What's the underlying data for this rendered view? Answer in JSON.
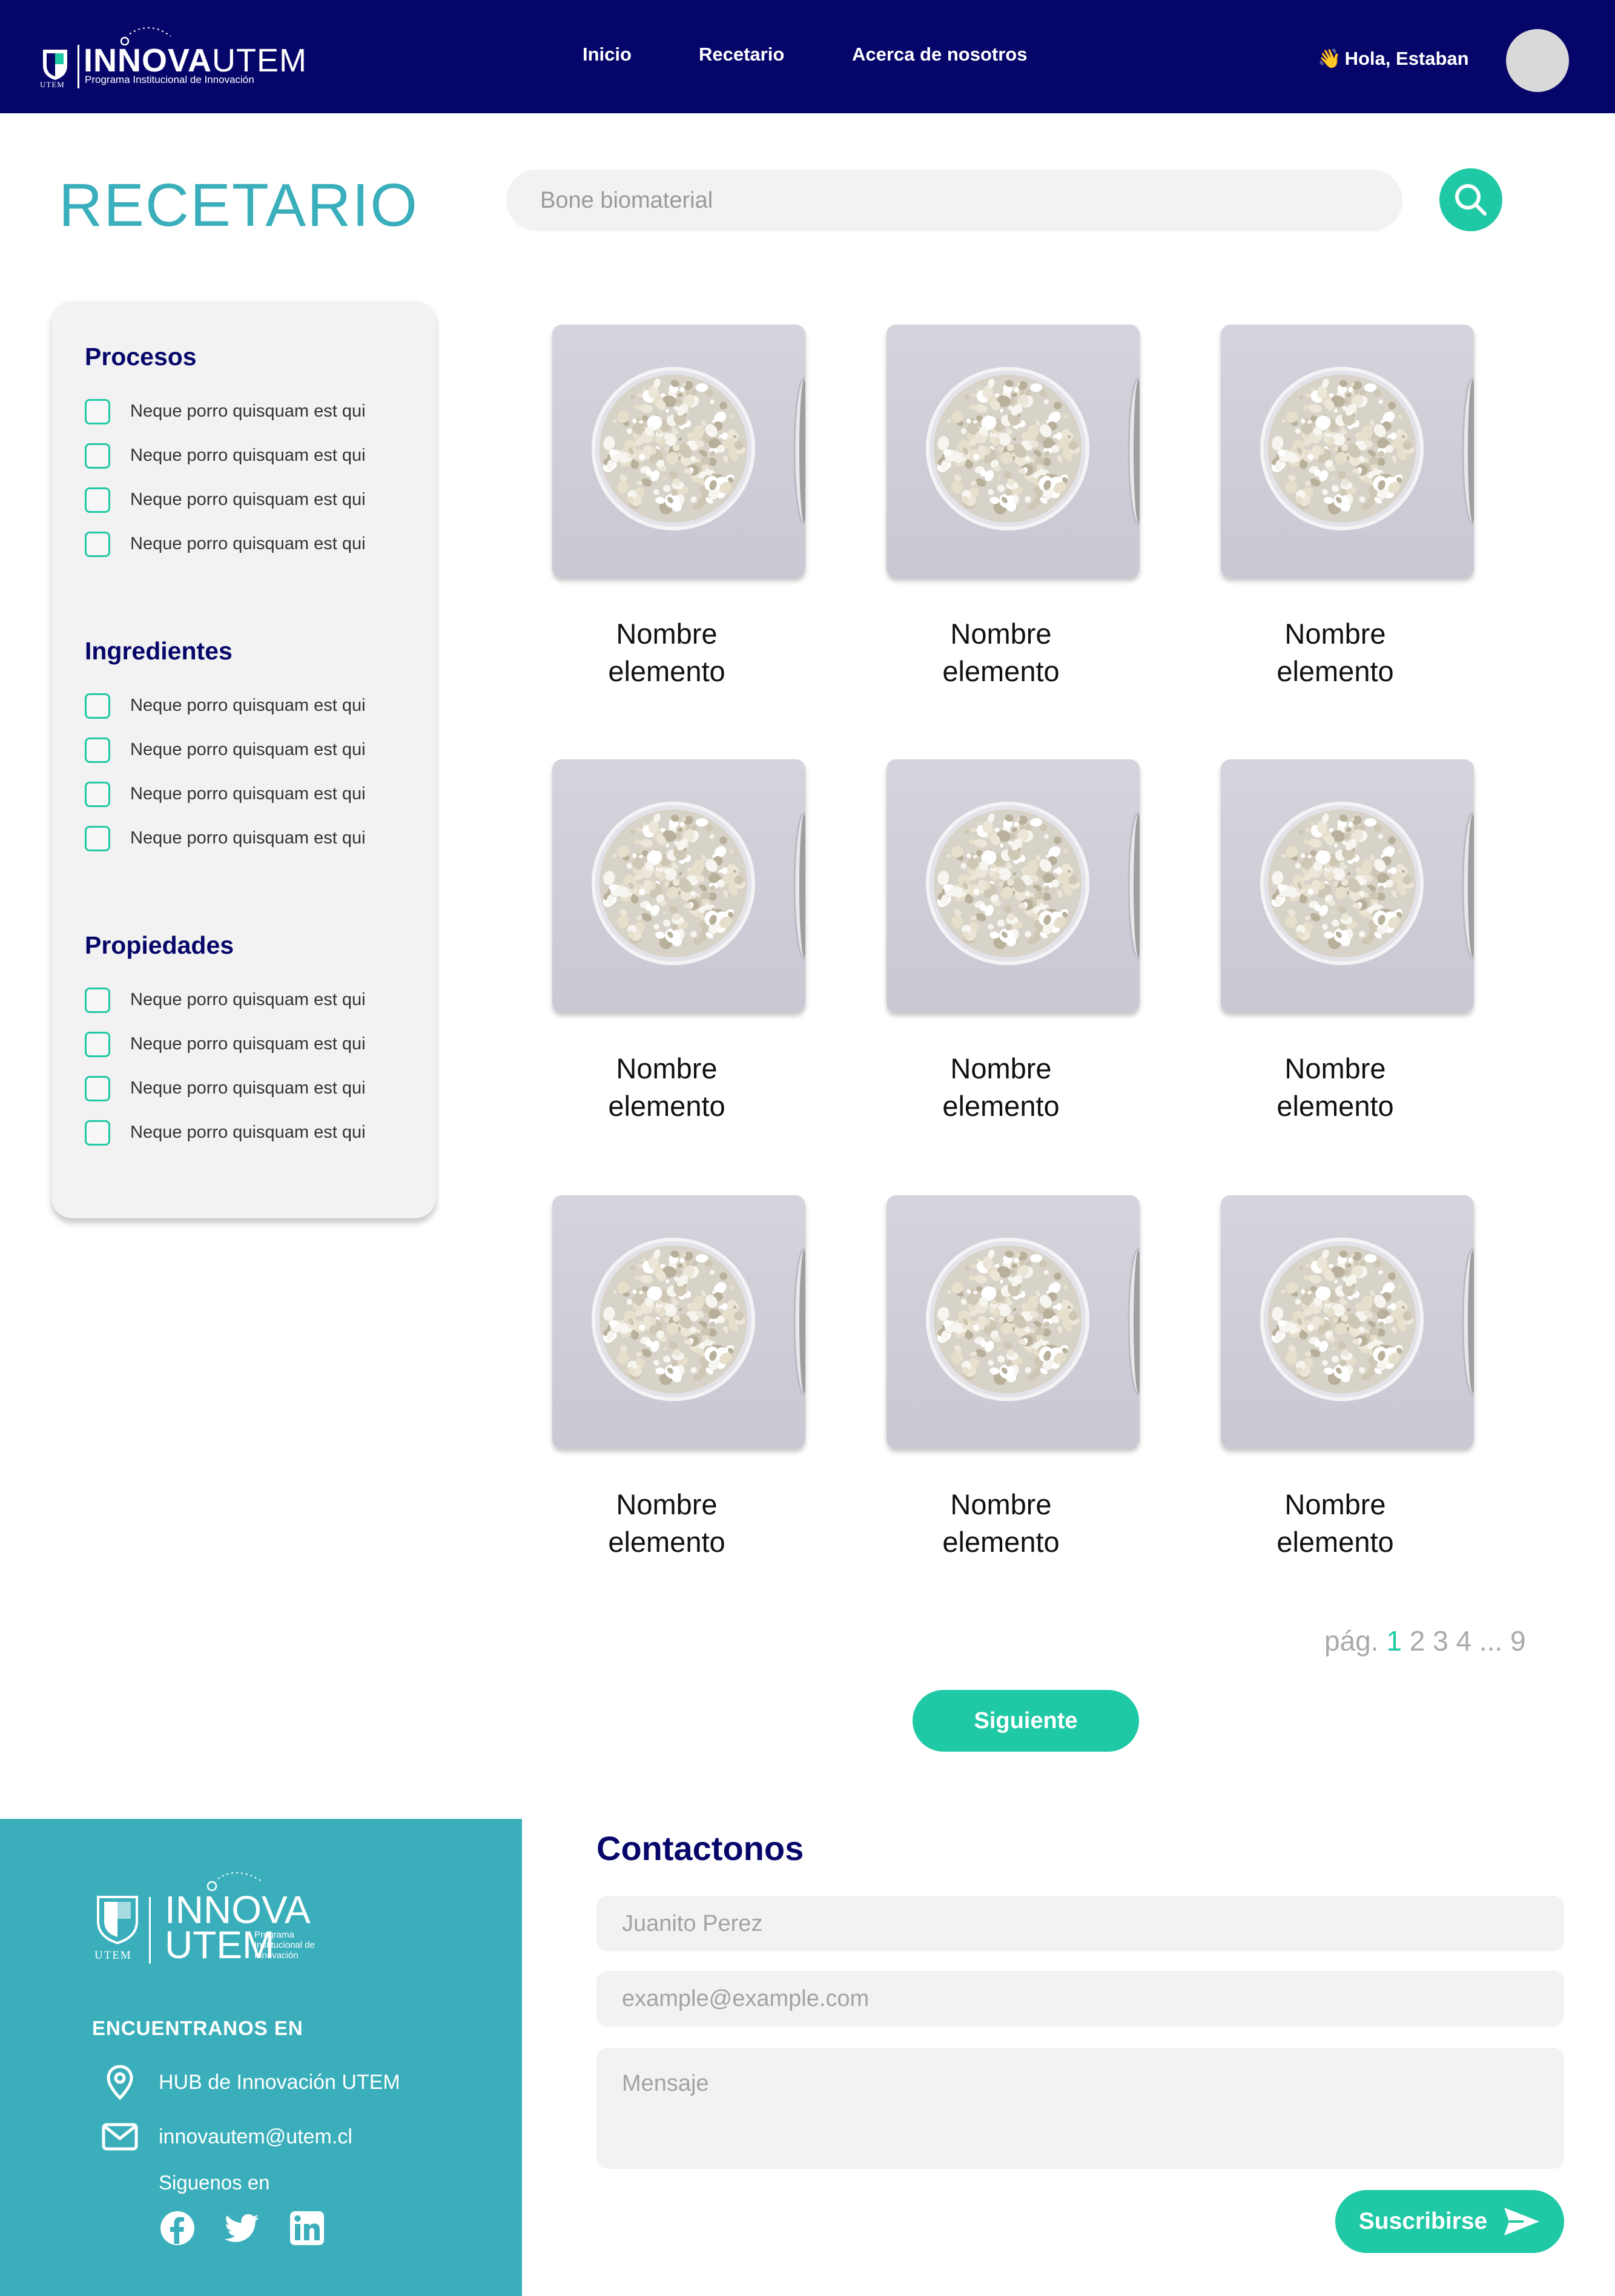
{
  "navbar": {
    "logo": {
      "word_bold": "INNOVA",
      "word_light": "UTEM",
      "subtitle": "Programa Institucional de Innovación",
      "shield_text": "UTEM"
    },
    "links": [
      {
        "label": "Inicio"
      },
      {
        "label": "Recetario"
      },
      {
        "label": "Acerca de nosotros"
      }
    ],
    "greeting_emoji": "👋",
    "greeting": "Hola, Estaban"
  },
  "header": {
    "title": "RECETARIO",
    "search_placeholder": "Bone biomaterial",
    "search_icon": "search-icon"
  },
  "filters": [
    {
      "title": "Procesos",
      "items": [
        "Neque porro quisquam est qui",
        "Neque porro quisquam est qui",
        "Neque porro quisquam est qui",
        "Neque porro quisquam est qui"
      ]
    },
    {
      "title": "Ingredientes",
      "items": [
        "Neque porro quisquam est qui",
        "Neque porro quisquam est qui",
        "Neque porro quisquam est qui",
        "Neque porro quisquam est qui"
      ]
    },
    {
      "title": "Propiedades",
      "items": [
        "Neque porro quisquam est qui",
        "Neque porro quisquam est qui",
        "Neque porro quisquam est qui",
        "Neque porro quisquam est qui"
      ]
    }
  ],
  "cards": [
    {
      "line1": "Nombre",
      "line2": "elemento"
    },
    {
      "line1": "Nombre",
      "line2": "elemento"
    },
    {
      "line1": "Nombre",
      "line2": "elemento"
    },
    {
      "line1": "Nombre",
      "line2": "elemento"
    },
    {
      "line1": "Nombre",
      "line2": "elemento"
    },
    {
      "line1": "Nombre",
      "line2": "elemento"
    },
    {
      "line1": "Nombre",
      "line2": "elemento"
    },
    {
      "line1": "Nombre",
      "line2": "elemento"
    },
    {
      "line1": "Nombre",
      "line2": "elemento"
    }
  ],
  "pagination": {
    "prefix": "pág.",
    "pages": [
      "1",
      "2",
      "3",
      "4",
      "...",
      "9"
    ],
    "active": "1",
    "next_label": "Siguiente"
  },
  "footer": {
    "logo": {
      "word1": "INNOVA",
      "word2": "UTEM",
      "subtitle": "Programa Institucional de Innovación",
      "shield_text": "UTEM"
    },
    "find_us": "ENCUENTRANOS EN",
    "location": "HUB de Innovación UTEM",
    "email": "innovautem@utem.cl",
    "follow_us": "Siguenos en",
    "socials": [
      "facebook-icon",
      "twitter-icon",
      "linkedin-icon"
    ]
  },
  "contact": {
    "title": "Contactonos",
    "name_placeholder": "Juanito Perez",
    "email_placeholder": "example@example.com",
    "message_placeholder": "Mensaje",
    "subscribe_label": "Suscribirse"
  },
  "colors": {
    "navy": "#06066a",
    "teal": "#3aafbb",
    "accent": "#20c9a5",
    "panel": "#f2f2f2"
  }
}
